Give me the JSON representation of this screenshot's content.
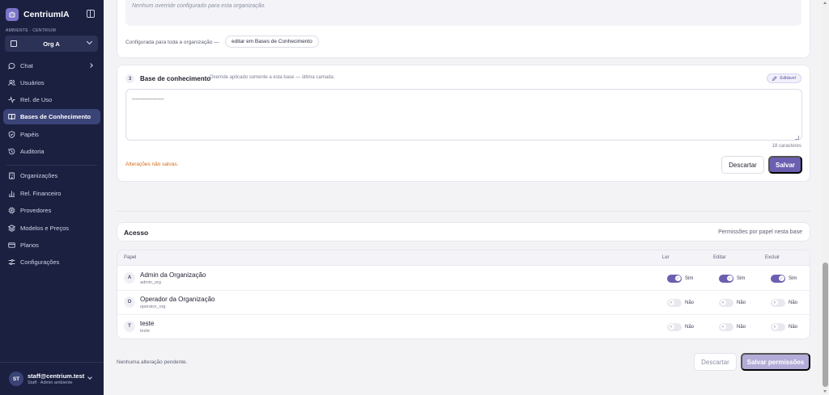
{
  "sidebar": {
    "brand": "CentriumIA",
    "env_label": "AMBIENTE · CENTRIUM",
    "org_selected": "Org A",
    "items": [
      {
        "label": "Chat"
      },
      {
        "label": "Usuários"
      },
      {
        "label": "Rel. de Uso"
      },
      {
        "label": "Bases de Conhecimento"
      },
      {
        "label": "Papéis"
      },
      {
        "label": "Auditoria"
      },
      {
        "label": "Organizações"
      },
      {
        "label": "Rel. Financeiro"
      },
      {
        "label": "Provedores"
      },
      {
        "label": "Modelos e Preços"
      },
      {
        "label": "Planos"
      },
      {
        "label": "Configurações"
      }
    ],
    "user": {
      "initials": "ST",
      "email": "staff@centrium.test",
      "role": "Staff · Admin ambiente"
    }
  },
  "org_section": {
    "empty_text": "Nenhum override configurado para esta organização.",
    "configured_text": "Configurada para toda a organização —",
    "link_label": "editar em Bases de Conhecimento"
  },
  "kb_section": {
    "step": "3",
    "title": "Base de conhecimento",
    "subtitle": "Override aplicado somente a esta base — última camada.",
    "badge": "Editável",
    "textarea_value": "-----------------",
    "char_count": "18 caracteres",
    "unsaved": "Alterações não salvas.",
    "discard_label": "Descartar",
    "save_label": "Salvar"
  },
  "access": {
    "title": "Acesso",
    "subtitle": "Permissões por papel nesta base",
    "columns": {
      "role": "Papel",
      "read": "Ler",
      "edit": "Editar",
      "delete": "Excluir"
    },
    "rows": [
      {
        "initial": "A",
        "name": "Admin da Organização",
        "code": "admin_org",
        "read": {
          "on": true,
          "label": "Sim"
        },
        "edit": {
          "on": true,
          "label": "Sim"
        },
        "delete": {
          "on": true,
          "label": "Sim"
        }
      },
      {
        "initial": "O",
        "name": "Operador da Organização",
        "code": "operator_org",
        "read": {
          "on": false,
          "label": "Não"
        },
        "edit": {
          "on": false,
          "label": "Não"
        },
        "delete": {
          "on": false,
          "label": "Não"
        }
      },
      {
        "initial": "T",
        "name": "teste",
        "code": "teste",
        "read": {
          "on": false,
          "label": "Não"
        },
        "edit": {
          "on": false,
          "label": "Não"
        },
        "delete": {
          "on": false,
          "label": "Não"
        }
      }
    ],
    "pending": "Nenhuma alteração pendente.",
    "discard_label": "Descartar",
    "save_label": "Salvar permissões"
  },
  "colors": {
    "sidebar_bg": "#1b2040",
    "accent": "#6a5fb0",
    "warning": "#d46a17"
  },
  "icons": {
    "nav": [
      "chat-icon",
      "users-icon",
      "activity-icon",
      "book-icon",
      "shield-icon",
      "history-icon",
      "building-icon",
      "bar-chart-icon",
      "cpu-icon",
      "layers-icon",
      "credit-card-icon",
      "sliders-icon"
    ]
  }
}
